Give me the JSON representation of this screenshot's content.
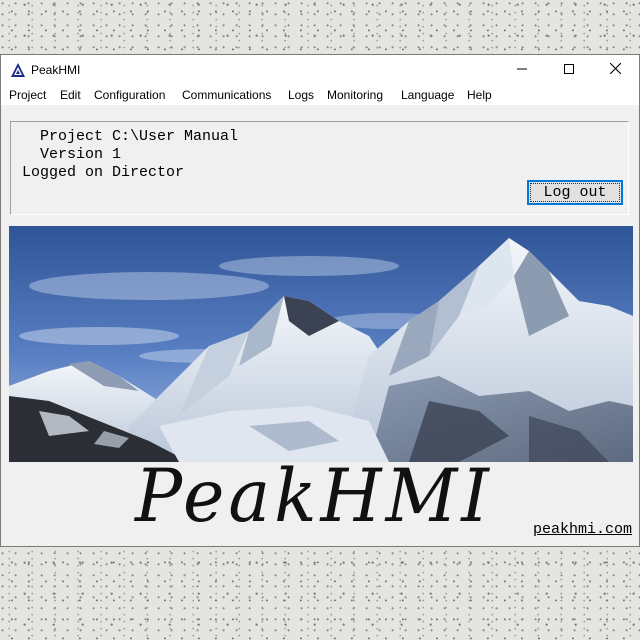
{
  "window": {
    "title": "PeakHMI"
  },
  "menu": [
    "Project",
    "Edit",
    "Configuration",
    "Communications",
    "Logs",
    "Monitoring",
    "Language",
    "Help"
  ],
  "info": {
    "project": "Project C:\\User Manual",
    "version": "Version 1",
    "logged_on": "Logged on Director"
  },
  "logout_label": "Log out",
  "logo_text": "PeakHMI",
  "site_link": "peakhmi.com",
  "colors": {
    "accent": "#0078d7",
    "window_bg": "#f0f0f0",
    "sky": "#3d62a8"
  },
  "icons": {
    "app": "peak-logo-icon",
    "minimize": "minimize-icon",
    "maximize": "maximize-icon",
    "close": "close-icon"
  }
}
